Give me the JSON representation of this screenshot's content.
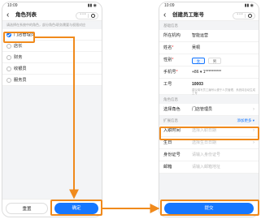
{
  "left_phone": {
    "status": {
      "time": "10:09",
      "signals": "▮▮ ◉"
    },
    "nav": {
      "back_glyph": "‹",
      "title": "角色列表",
      "more_glyph": "···"
    },
    "hint": "请选择在系统中的角色，部分角色/职务需要与权限对应",
    "roles": [
      {
        "label": "门店管理员",
        "checked": true
      },
      {
        "label": "店长",
        "checked": false
      },
      {
        "label": "财务",
        "checked": false
      },
      {
        "label": "收银员",
        "checked": false
      },
      {
        "label": "服务员",
        "checked": false
      }
    ],
    "buttons": {
      "reset": "重置",
      "confirm": "确定"
    }
  },
  "right_phone": {
    "status": {
      "time": "10:09",
      "signals": "▮▮ ◉"
    },
    "nav": {
      "back_glyph": "‹",
      "title": "创建员工账号",
      "more_glyph": "···"
    },
    "sections": {
      "basic": "基础信息",
      "role": "角色信息",
      "extra": "扩展信息",
      "extra_more": "添加更多 ▾"
    },
    "fields": {
      "org": {
        "label": "所在机构",
        "value": "智能运营"
      },
      "name": {
        "label": "姓名",
        "value": "吴桐"
      },
      "gender": {
        "label": "性别",
        "options": [
          "女",
          "男"
        ],
        "selected": "女"
      },
      "phone": {
        "label": "手机号",
        "value": "+86 ▾  1**********"
      },
      "employee_no": {
        "label": "工号",
        "value": "10003",
        "note": "建议填写员工编号以便于人员管理，系统将自动生成工号"
      },
      "role": {
        "label": "选择角色",
        "value": "门店管理员"
      },
      "entry_date": {
        "label": "入职时间",
        "placeholder": "选择入职日期"
      },
      "birthday": {
        "label": "生日",
        "placeholder": "选择生日日期"
      },
      "id_card": {
        "label": "身份证号",
        "placeholder": "请输入身份证号"
      },
      "email": {
        "label": "邮箱",
        "placeholder": "请输入邮箱地址"
      }
    },
    "buttons": {
      "submit": "提交"
    }
  },
  "annotation": {
    "color": "#f08a1c",
    "accent": "#1677ff"
  }
}
